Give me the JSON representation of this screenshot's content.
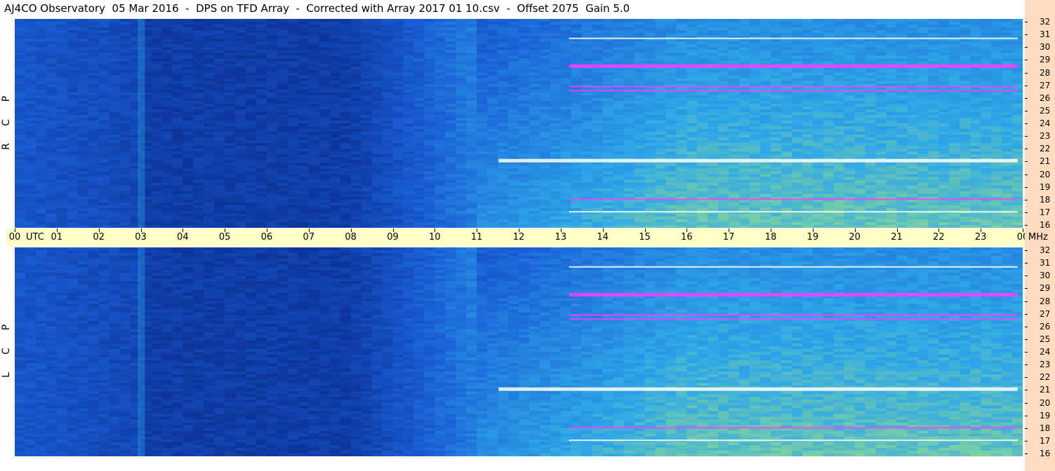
{
  "title": "AJ4CO Observatory  05 Mar 2016  -  DPS on TFD Array  -  Corrected with Array 2017 01 10.csv  -  Offset 2075  Gain 5.0",
  "chart_data": {
    "type": "heatmap",
    "panels": [
      {
        "name": "RCP",
        "label_letters": [
          "P",
          "C",
          "R"
        ]
      },
      {
        "name": "LCP",
        "label_letters": [
          "P",
          "C",
          "L"
        ]
      }
    ],
    "x_axis": {
      "label": "UTC",
      "ticks": [
        "00",
        "01",
        "02",
        "03",
        "04",
        "05",
        "06",
        "07",
        "08",
        "09",
        "10",
        "11",
        "12",
        "13",
        "14",
        "15",
        "16",
        "17",
        "18",
        "19",
        "20",
        "21",
        "22",
        "23",
        "00"
      ],
      "range": [
        0,
        24
      ]
    },
    "y_axis": {
      "unit": "MHz",
      "ticks": [
        "16",
        "17",
        "18",
        "19",
        "20",
        "21",
        "22",
        "23",
        "24",
        "25",
        "26",
        "27",
        "28",
        "29",
        "30",
        "31",
        "32"
      ],
      "range": [
        16,
        32
      ]
    },
    "colors": {
      "night_low": "#0a2a8c",
      "base": "#1a5fd6",
      "mid": "#2fa8e8",
      "high": "#b9f06a",
      "strong": "#ffffff",
      "peak": "#ff3cff"
    }
  }
}
